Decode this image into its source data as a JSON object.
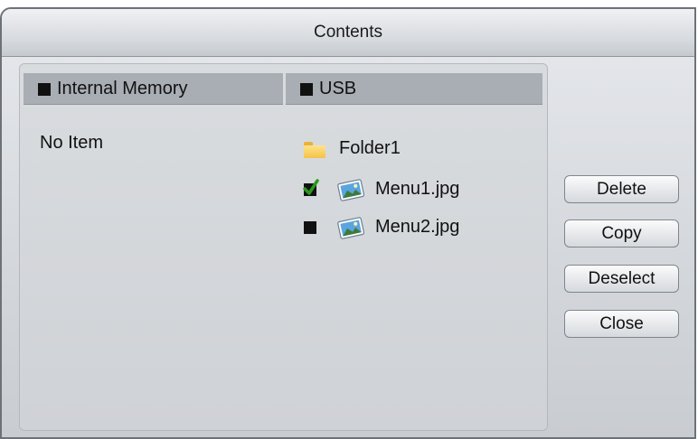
{
  "window": {
    "title": "Contents"
  },
  "columns": [
    {
      "label": "Internal Memory"
    },
    {
      "label": "USB"
    }
  ],
  "internal_memory": {
    "empty_text": "No Item"
  },
  "usb_items": [
    {
      "name": "Folder1",
      "type": "folder",
      "icon": "folder-icon"
    },
    {
      "name": "Menu1.jpg",
      "type": "image",
      "icon": "image-file-icon",
      "checked": true
    },
    {
      "name": "Menu2.jpg",
      "type": "image",
      "icon": "image-file-icon",
      "checked": false
    }
  ],
  "buttons": [
    {
      "label": "Delete"
    },
    {
      "label": "Copy"
    },
    {
      "label": "Deselect"
    },
    {
      "label": "Close"
    }
  ],
  "colors": {
    "check": "#2a9a1c",
    "folder": "#f4c24a",
    "column_header": "#a9aeb4"
  }
}
